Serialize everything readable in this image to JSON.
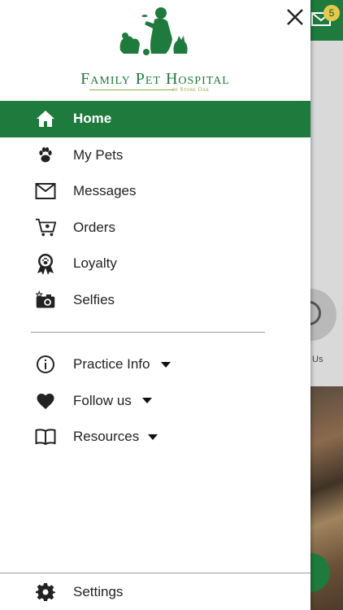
{
  "background": {
    "messages_badge": "5",
    "partial_label": "Us"
  },
  "drawer": {
    "logo": {
      "title": "Family Pet Hospital",
      "subtitle": "of Stone Oak"
    },
    "main_items": [
      {
        "label": "Home",
        "icon": "home-icon",
        "active": true
      },
      {
        "label": "My Pets",
        "icon": "paw-icon"
      },
      {
        "label": "Messages",
        "icon": "envelope-icon"
      },
      {
        "label": "Orders",
        "icon": "cart-icon"
      },
      {
        "label": "Loyalty",
        "icon": "ribbon-badge-icon"
      },
      {
        "label": "Selfies",
        "icon": "camera-icon"
      }
    ],
    "secondary_items": [
      {
        "label": "Practice Info",
        "icon": "info-icon"
      },
      {
        "label": "Follow us",
        "icon": "heart-icon"
      },
      {
        "label": "Resources",
        "icon": "book-icon"
      }
    ],
    "settings_label": "Settings"
  },
  "colors": {
    "brand_green": "#1e7a3d",
    "badge_yellow": "#e4c94b"
  }
}
